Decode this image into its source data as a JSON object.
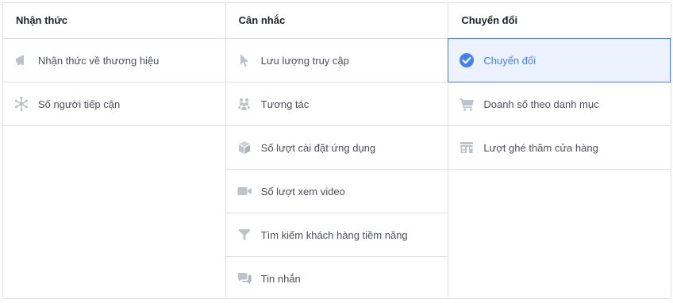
{
  "columns": [
    {
      "title": "Nhận thức",
      "items": [
        {
          "label": "Nhận thức về thương hiệu",
          "icon": "megaphone-icon"
        },
        {
          "label": "Số người tiếp cận",
          "icon": "asterisk-icon"
        }
      ]
    },
    {
      "title": "Cân nhắc",
      "items": [
        {
          "label": "Lưu lượng truy cập",
          "icon": "cursor-icon"
        },
        {
          "label": "Tương tác",
          "icon": "people-icon"
        },
        {
          "label": "Số lượt cài đặt ứng dụng",
          "icon": "box-icon"
        },
        {
          "label": "Số lượt xem video",
          "icon": "video-camera-icon"
        },
        {
          "label": "Tìm kiếm khách hàng tiềm năng",
          "icon": "funnel-icon"
        },
        {
          "label": "Tin nhắn",
          "icon": "chat-bubbles-icon"
        }
      ]
    },
    {
      "title": "Chuyển đổi",
      "items": [
        {
          "label": "Chuyển đổi",
          "icon": "check-circle-icon",
          "selected": true
        },
        {
          "label": "Doanh số theo danh mục",
          "icon": "shopping-cart-icon"
        },
        {
          "label": "Lượt ghé thăm cửa hàng",
          "icon": "storefront-icon"
        }
      ]
    }
  ],
  "colors": {
    "border": "#dddfe2",
    "icon_gray": "#bec3c9",
    "selected_bg": "#ecf3ff",
    "selected_accent": "#4080ff",
    "text": "#4b4f56"
  }
}
